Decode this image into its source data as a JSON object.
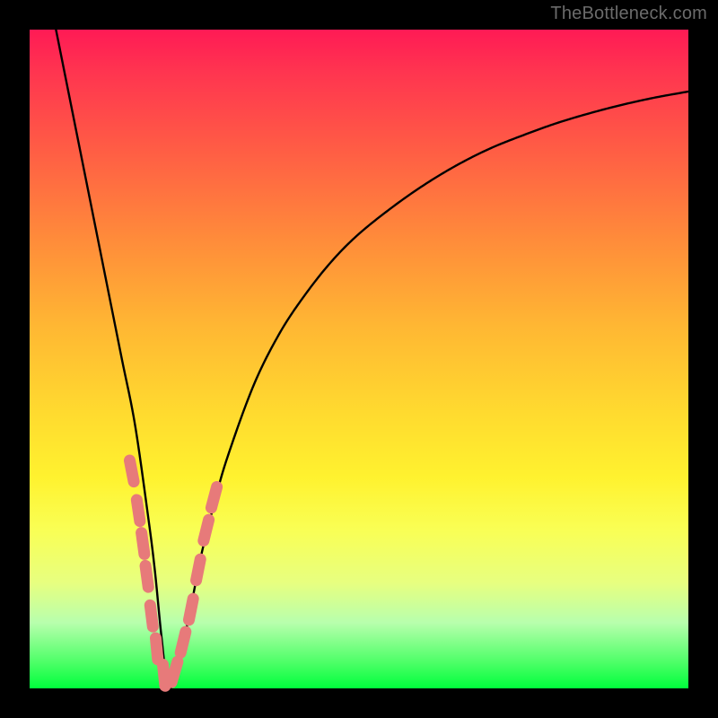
{
  "watermark": "TheBottleneck.com",
  "chart_data": {
    "type": "line",
    "title": "",
    "xlabel": "",
    "ylabel": "",
    "xlim": [
      0,
      100
    ],
    "ylim": [
      0,
      100
    ],
    "grid": false,
    "series": [
      {
        "name": "bottleneck-curve",
        "color": "#000000",
        "x": [
          4,
          6,
          8,
          10,
          12,
          14,
          16,
          18,
          19,
          20,
          21,
          22,
          24,
          26,
          28,
          30,
          34,
          38,
          42,
          46,
          50,
          55,
          60,
          65,
          70,
          75,
          80,
          85,
          90,
          95,
          100
        ],
        "y": [
          100,
          90,
          80,
          70,
          60,
          50,
          40,
          26,
          18,
          8,
          0,
          2,
          10,
          20,
          28,
          35,
          46,
          54,
          60,
          65,
          69,
          73,
          76.5,
          79.5,
          82,
          84,
          85.8,
          87.3,
          88.6,
          89.7,
          90.6
        ]
      }
    ],
    "markers": [
      {
        "name": "highlight-dashes",
        "color": "#e77a7a",
        "points": [
          {
            "x": 15.5,
            "y": 33
          },
          {
            "x": 16.5,
            "y": 27
          },
          {
            "x": 17.2,
            "y": 22
          },
          {
            "x": 17.8,
            "y": 17
          },
          {
            "x": 18.5,
            "y": 11
          },
          {
            "x": 19.3,
            "y": 6
          },
          {
            "x": 20.4,
            "y": 2
          },
          {
            "x": 22.0,
            "y": 2.5
          },
          {
            "x": 23.3,
            "y": 7
          },
          {
            "x": 24.5,
            "y": 12
          },
          {
            "x": 25.6,
            "y": 18
          },
          {
            "x": 26.8,
            "y": 24
          },
          {
            "x": 28.0,
            "y": 29
          }
        ]
      }
    ]
  }
}
